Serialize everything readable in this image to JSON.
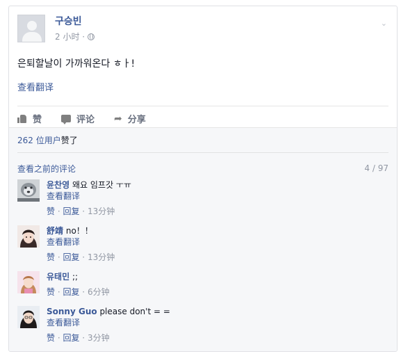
{
  "post": {
    "author": "구승빈",
    "time": "2 小时 ·",
    "text": "은퇴할날이 가까워온다 ㅎㅏ!",
    "translate": "查看翻译"
  },
  "actions": {
    "like": "赞",
    "comment": "评论",
    "share": "分享"
  },
  "likes": {
    "count": "262 位用户",
    "label": "赞了"
  },
  "comments_header": {
    "previous": "查看之前的评论",
    "pager": "4 / 97"
  },
  "comments": [
    {
      "name": "윤찬영",
      "text": "왜요 임프갓 ㅜㅠ",
      "translate": "查看翻译",
      "like": "赞",
      "reply": "回复",
      "time": "13分钟"
    },
    {
      "name": "舒靖",
      "text": "no！！",
      "translate": "查看翻译",
      "like": "赞",
      "reply": "回复",
      "time": "13分钟"
    },
    {
      "name": "유태민",
      "text": ";;",
      "translate": "",
      "like": "赞",
      "reply": "回复",
      "time": "6分钟"
    },
    {
      "name": "Sonny Guo",
      "text": "please don't = =",
      "translate": "查看翻译",
      "like": "赞",
      "reply": "回复",
      "time": "3分钟"
    }
  ],
  "colors": {
    "link": "#3b5998",
    "muted": "#9197a3",
    "ufi_bg": "#f6f7f9"
  }
}
